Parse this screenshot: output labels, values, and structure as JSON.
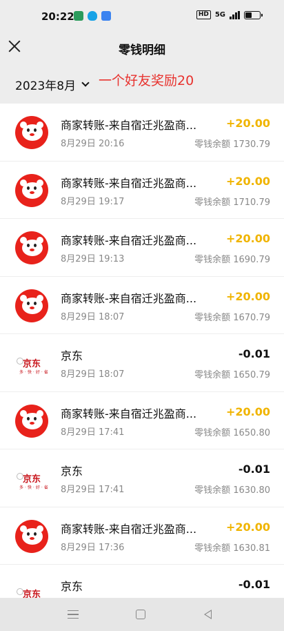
{
  "status_bar": {
    "time": "20:22",
    "hd_label": "HD",
    "network": "5G",
    "battery_percent": 45
  },
  "header": {
    "title": "零钱明细",
    "close_icon": "close-icon"
  },
  "filter": {
    "month": "2023年8月",
    "annotation": "一个好友奖励20"
  },
  "transactions": [
    {
      "title": "商家转账-来自宿迁兆盈商...",
      "time": "8月29日 20:16",
      "amount": "+20.00",
      "direction": "in",
      "balance": "零钱余额 1730.79",
      "avatar": "jd-mascot"
    },
    {
      "title": "商家转账-来自宿迁兆盈商...",
      "time": "8月29日 19:17",
      "amount": "+20.00",
      "direction": "in",
      "balance": "零钱余额 1710.79",
      "avatar": "jd-mascot"
    },
    {
      "title": "商家转账-来自宿迁兆盈商...",
      "time": "8月29日 19:13",
      "amount": "+20.00",
      "direction": "in",
      "balance": "零钱余额 1690.79",
      "avatar": "jd-mascot"
    },
    {
      "title": "商家转账-来自宿迁兆盈商...",
      "time": "8月29日 18:07",
      "amount": "+20.00",
      "direction": "in",
      "balance": "零钱余额 1670.79",
      "avatar": "jd-mascot"
    },
    {
      "title": "京东",
      "time": "8月29日 18:07",
      "amount": "-0.01",
      "direction": "out",
      "balance": "零钱余额 1650.79",
      "avatar": "jd-store",
      "logo_text": "京东",
      "logo_tagline": "多·快·好·省"
    },
    {
      "title": "商家转账-来自宿迁兆盈商...",
      "time": "8月29日 17:41",
      "amount": "+20.00",
      "direction": "in",
      "balance": "零钱余额 1650.80",
      "avatar": "jd-mascot"
    },
    {
      "title": "京东",
      "time": "8月29日 17:41",
      "amount": "-0.01",
      "direction": "out",
      "balance": "零钱余额 1630.80",
      "avatar": "jd-store",
      "logo_text": "京东",
      "logo_tagline": "多·快·好·省"
    },
    {
      "title": "商家转账-来自宿迁兆盈商...",
      "time": "8月29日 17:36",
      "amount": "+20.00",
      "direction": "in",
      "balance": "零钱余额 1630.81",
      "avatar": "jd-mascot"
    },
    {
      "title": "京东",
      "time": "",
      "amount": "-0.01",
      "direction": "out",
      "balance": "",
      "avatar": "jd-store",
      "logo_text": "京东",
      "logo_tagline": ""
    }
  ],
  "colors": {
    "income": "#f0b400",
    "annotation": "#e8332f",
    "jd_red": "#e8221b"
  },
  "system_nav": {
    "menu_icon": "menu-icon",
    "home_icon": "home-icon",
    "back_icon": "back-icon"
  }
}
